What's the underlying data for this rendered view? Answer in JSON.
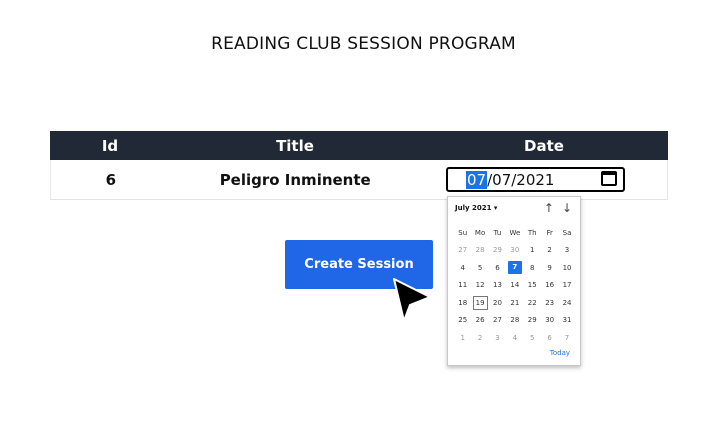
{
  "page": {
    "title": "READING CLUB SESSION PROGRAM"
  },
  "table": {
    "headers": [
      "Id",
      "Title",
      "Date"
    ],
    "rows": [
      {
        "id": "6",
        "title": "Peligro Inminente",
        "date_month": "07",
        "date_rest": "/07/2021"
      }
    ]
  },
  "actions": {
    "create_label": "Create Session"
  },
  "calendar": {
    "month_label": "July 2021 ▾",
    "nav_up": "↑",
    "nav_down": "↓",
    "weekdays": [
      "Su",
      "Mo",
      "Tu",
      "We",
      "Th",
      "Fr",
      "Sa"
    ],
    "weeks": [
      [
        "27",
        "28",
        "29",
        "30",
        "1",
        "2",
        "3"
      ],
      [
        "4",
        "5",
        "6",
        "7",
        "8",
        "9",
        "10"
      ],
      [
        "11",
        "12",
        "13",
        "14",
        "15",
        "16",
        "17"
      ],
      [
        "18",
        "19",
        "20",
        "21",
        "22",
        "23",
        "24"
      ],
      [
        "25",
        "26",
        "27",
        "28",
        "29",
        "30",
        "31"
      ],
      [
        "1",
        "2",
        "3",
        "4",
        "5",
        "6",
        "7"
      ]
    ],
    "selected_day": "7",
    "today_day": "19",
    "today_label": "Today"
  },
  "colors": {
    "header_bg": "#212936",
    "button_bg": "#1f67e6",
    "accent": "#1a73e8"
  },
  "icons": {
    "calendar": "calendar-icon",
    "cursor": "mouse-pointer-icon"
  }
}
